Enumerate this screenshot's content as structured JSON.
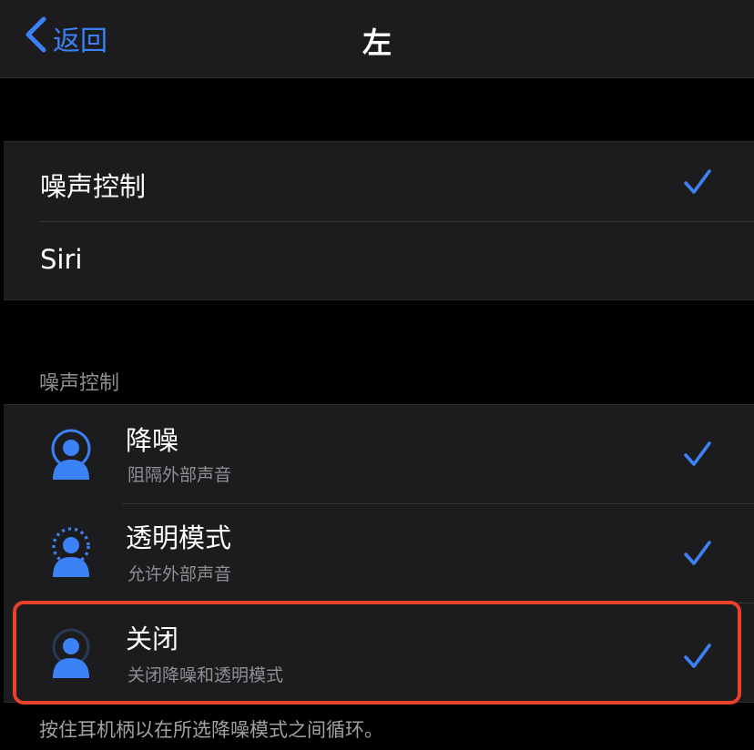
{
  "nav": {
    "back_label": "返回",
    "title": "左"
  },
  "press_hold": {
    "items": [
      {
        "label": "噪声控制",
        "selected": true
      },
      {
        "label": "Siri",
        "selected": false
      }
    ]
  },
  "noise_control": {
    "header": "噪声控制",
    "modes": [
      {
        "title": "降噪",
        "subtitle": "阻隔外部声音",
        "icon": "noise-cancellation-icon",
        "checked": true
      },
      {
        "title": "透明模式",
        "subtitle": "允许外部声音",
        "icon": "transparency-icon",
        "checked": true
      },
      {
        "title": "关闭",
        "subtitle": "关闭降噪和透明模式",
        "icon": "off-icon",
        "checked": true
      }
    ],
    "footer": "按住耳机柄以在所选降噪模式之间循环。"
  },
  "colors": {
    "accent": "#3b82f6",
    "highlight": "#e8402a",
    "cell_bg": "#1c1c1e",
    "bg": "#000000"
  }
}
